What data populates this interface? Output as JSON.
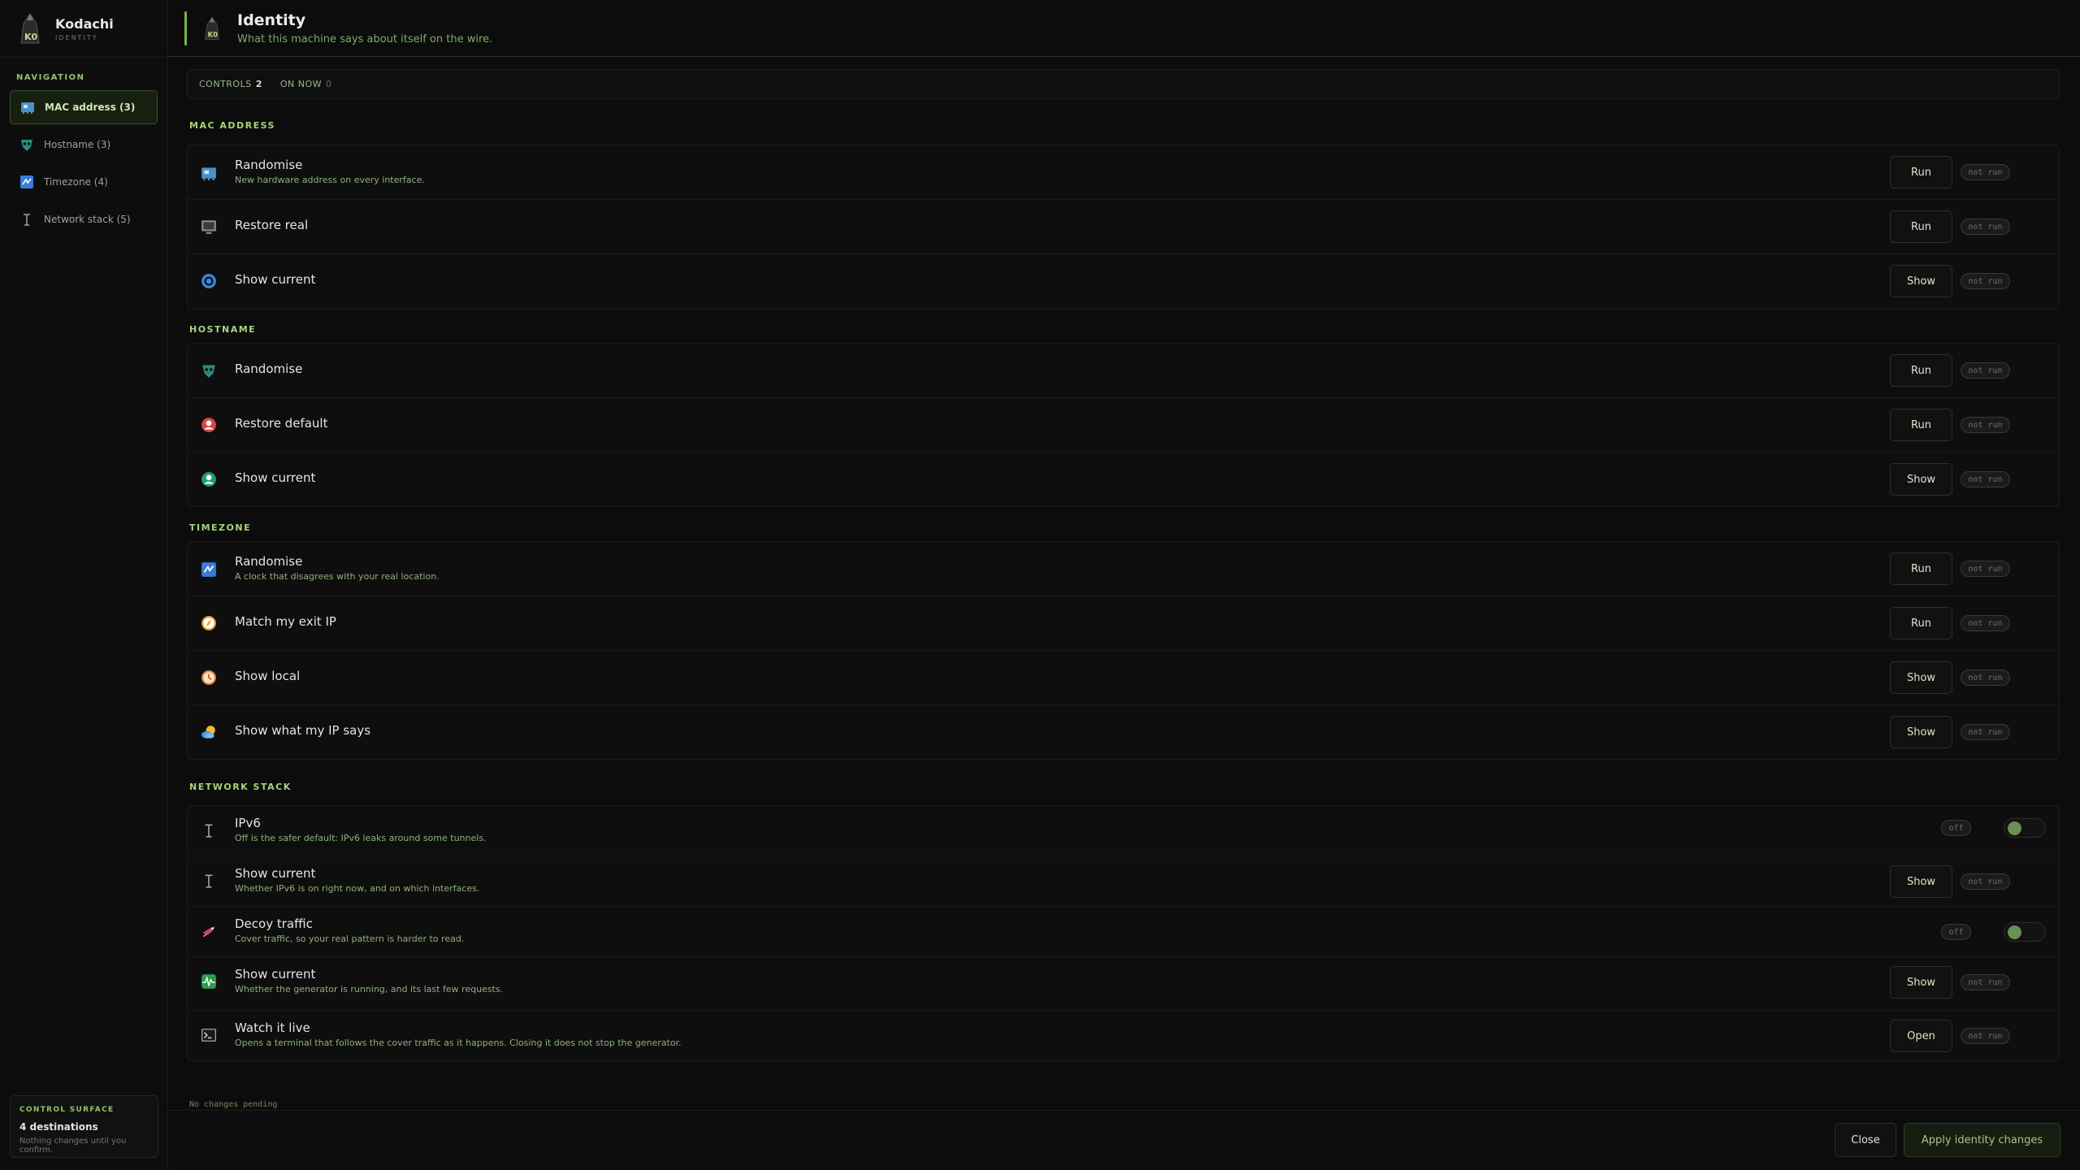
{
  "brand": {
    "name": "Kodachi",
    "sub": "IDENTITY"
  },
  "nav": {
    "title": "NAVIGATION",
    "items": [
      {
        "label": "MAC address (3)",
        "icon": "network-card-icon",
        "active": true
      },
      {
        "label": "Hostname (3)",
        "icon": "mask-icon",
        "active": false
      },
      {
        "label": "Timezone (4)",
        "icon": "shuffle-icon",
        "active": false
      },
      {
        "label": "Network stack (5)",
        "icon": "antenna-icon",
        "active": false
      }
    ]
  },
  "surface": {
    "title": "CONTROL SURFACE",
    "destinations": "4 destinations",
    "note": "Nothing changes until you confirm."
  },
  "header": {
    "title": "Identity",
    "subtitle": "What this machine says about itself on the wire."
  },
  "tabs": [
    {
      "label": "CONTROLS",
      "count": "2"
    },
    {
      "label": "ON NOW",
      "count": "0"
    }
  ],
  "sections": {
    "mac": {
      "title": "MAC ADDRESS",
      "rows": [
        {
          "title": "Randomise",
          "desc": "New hardware address on every interface.",
          "button": "Run",
          "status": "not run",
          "icon": "network-card-icon"
        },
        {
          "title": "Restore real",
          "desc": "",
          "button": "Run",
          "status": "not run",
          "icon": "monitor-icon"
        },
        {
          "title": "Show current",
          "desc": "",
          "button": "Show",
          "status": "not run",
          "icon": "target-icon"
        }
      ]
    },
    "hostname": {
      "title": "HOSTNAME",
      "rows": [
        {
          "title": "Randomise",
          "desc": "",
          "button": "Run",
          "status": "not run",
          "icon": "mask-icon"
        },
        {
          "title": "Restore default",
          "desc": "",
          "button": "Run",
          "status": "not run",
          "icon": "user-icon"
        },
        {
          "title": "Show current",
          "desc": "",
          "button": "Show",
          "status": "not run",
          "icon": "user-icon"
        }
      ]
    },
    "timezone": {
      "title": "TIMEZONE",
      "rows": [
        {
          "title": "Randomise",
          "desc": "A clock that disagrees with your real location.",
          "button": "Run",
          "status": "not run",
          "icon": "shuffle-icon"
        },
        {
          "title": "Match my exit IP",
          "desc": "",
          "button": "Run",
          "status": "not run",
          "icon": "compass-icon"
        },
        {
          "title": "Show local",
          "desc": "",
          "button": "Show",
          "status": "not run",
          "icon": "clock-icon"
        },
        {
          "title": "Show what my IP says",
          "desc": "",
          "button": "Show",
          "status": "not run",
          "icon": "weather-icon"
        }
      ]
    },
    "network": {
      "title": "NETWORK STACK",
      "rows": [
        {
          "title": "IPv6",
          "desc": "Off is the safer default: IPv6 leaks around some tunnels.",
          "button": "",
          "status": "off",
          "icon": "antenna-icon",
          "toggle": true
        },
        {
          "title": "Show current",
          "desc": "Whether IPv6 is on right now, and on which interfaces.",
          "button": "Show",
          "status": "not run",
          "icon": "antenna-icon"
        },
        {
          "title": "Decoy traffic",
          "desc": "Cover traffic, so your real pattern is harder to read.",
          "button": "",
          "status": "off",
          "icon": "decoy-icon",
          "toggle": true
        },
        {
          "title": "Show current",
          "desc": "Whether the generator is running, and its last few requests.",
          "button": "Show",
          "status": "not run",
          "icon": "activity-icon"
        },
        {
          "title": "Watch it live",
          "desc": "Opens a terminal that follows the cover traffic as it happens. Closing it does not stop the generator.",
          "button": "Open",
          "status": "not run",
          "icon": "terminal-icon"
        }
      ]
    }
  },
  "footer": {
    "pending": "No changes pending",
    "close": "Close",
    "apply": "Apply identity changes"
  }
}
